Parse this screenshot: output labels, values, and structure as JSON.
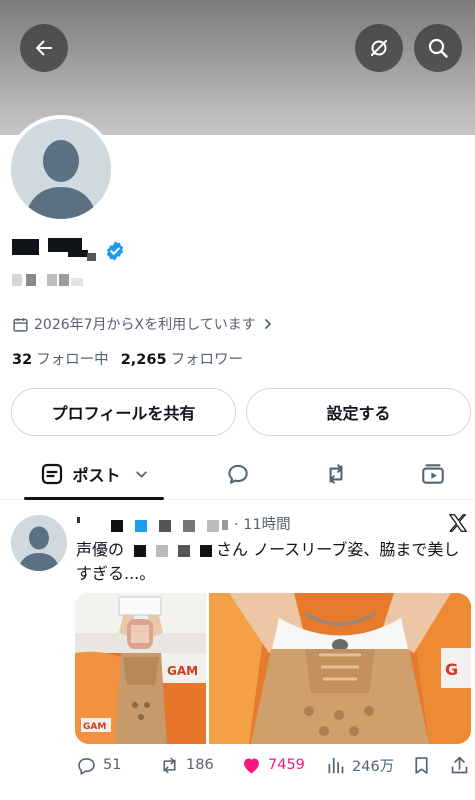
{
  "header": {
    "back_icon": "arrow-left-icon",
    "actions": [
      "edit-profile-icon",
      "search-icon"
    ]
  },
  "profile": {
    "joined_text": "2026年7月からXを利用しています",
    "following_count": "32",
    "following_label": "フォロー中",
    "followers_count": "2,265",
    "followers_label": "フォロワー",
    "verified_color": "#1d9bf0"
  },
  "buttons": {
    "share_profile": "プロフィールを共有",
    "settings": "設定する"
  },
  "tabs": {
    "posts_label": "ポスト",
    "icons": [
      "posts-icon",
      "replies-icon",
      "reposts-icon",
      "media-icon"
    ]
  },
  "post": {
    "time": "· 11時間",
    "text_start": "声優の",
    "text_rest": "さん ノースリーブ姿、脇まで美しすぎる...。",
    "replies": "51",
    "reposts": "186",
    "likes": "7459",
    "views": "246万",
    "like_color": "#f91880"
  }
}
